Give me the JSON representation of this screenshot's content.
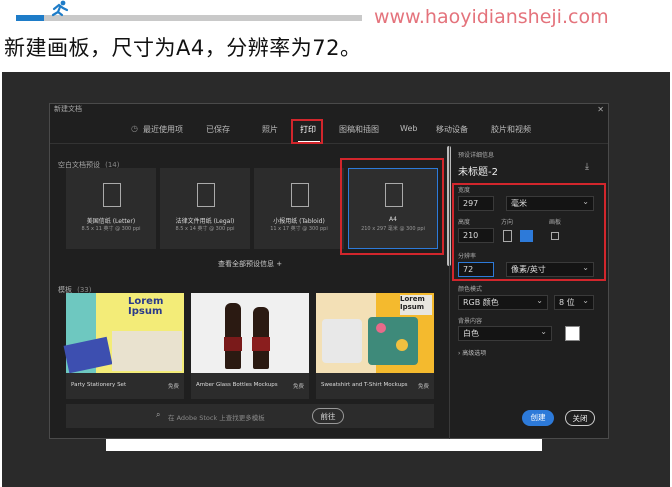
{
  "watermark": {
    "url": "www.haoyidiansheji.com"
  },
  "caption": "新建画板，尺寸为A4，分辨率为72。",
  "dialog": {
    "title": "新建文档",
    "close": "✕",
    "tabs": [
      {
        "label": "最近使用项"
      },
      {
        "label": "已保存"
      },
      {
        "label": "照片"
      },
      {
        "label": "打印"
      },
      {
        "label": "图稿和插图"
      },
      {
        "label": "Web"
      },
      {
        "label": "移动设备"
      },
      {
        "label": "胶片和视频"
      }
    ],
    "blank_presets_title": "空白文档预设",
    "blank_presets_count": "(14)",
    "presets": [
      {
        "name": "美国信纸 (Letter)",
        "size": "8.5 x 11 英寸 @ 300 ppi"
      },
      {
        "name": "法律文件用纸 (Legal)",
        "size": "8.5 x 14 英寸 @ 300 ppi"
      },
      {
        "name": "小报用纸 (Tabloid)",
        "size": "11 x 17 英寸 @ 300 ppi"
      },
      {
        "name": "A4",
        "size": "210 x 297 毫米 @ 300 ppi"
      }
    ],
    "view_all": "查看全部预设信息 +",
    "templates_title": "模板",
    "templates_count": "(33)",
    "templates": [
      {
        "name": "Party Stationery Set",
        "price": "免费",
        "overlay": "Lorem Ipsum"
      },
      {
        "name": "Amber Glass Bottles Mockups",
        "price": "免费"
      },
      {
        "name": "Sweatshirt and T-Shirt Mockups",
        "price": "免费",
        "overlay": "Lorem Ipsum"
      }
    ],
    "stock_search_placeholder": "在 Adobe Stock 上查找更多模板",
    "go_button": "前往",
    "details": {
      "section_title": "预设详细信息",
      "doc_name": "未标题-2",
      "width_label": "宽度",
      "width_value": "297",
      "width_unit": "毫米",
      "height_label": "高度",
      "height_value": "210",
      "orientation_label": "方向",
      "artboard_label": "画板",
      "resolution_label": "分辨率",
      "resolution_value": "72",
      "resolution_unit": "像素/英寸",
      "color_mode_label": "颜色模式",
      "color_mode_value": "RGB 颜色",
      "bit_depth_value": "8 位",
      "background_label": "背景内容",
      "background_value": "白色",
      "advanced": "› 高级选项"
    },
    "create_button": "创建",
    "close_button": "关闭"
  },
  "colors": {
    "accent": "#2d7ad9",
    "highlight": "#d2262c",
    "url": "#e4737c"
  }
}
